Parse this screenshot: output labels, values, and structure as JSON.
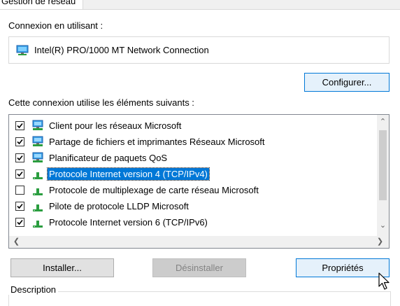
{
  "tab": {
    "label": "Gestion de réseau"
  },
  "connect_using": {
    "label": "Connexion en utilisant :",
    "adapter_name": "Intel(R) PRO/1000 MT Network Connection",
    "adapter_icon": "network-adapter-icon"
  },
  "configure_button": {
    "label": "Configurer..."
  },
  "items_section": {
    "label": "Cette connexion utilise les éléments suivants :",
    "items": [
      {
        "label": "Client pour les réseaux Microsoft",
        "checked": true,
        "icon": "network-client-icon",
        "selected": false
      },
      {
        "label": "Partage de fichiers et imprimantes Réseaux Microsoft",
        "checked": true,
        "icon": "file-printer-sharing-icon",
        "selected": false
      },
      {
        "label": "Planificateur de paquets QoS",
        "checked": true,
        "icon": "qos-scheduler-icon",
        "selected": false
      },
      {
        "label": "Protocole Internet version 4 (TCP/IPv4)",
        "checked": true,
        "icon": "protocol-icon",
        "selected": true
      },
      {
        "label": "Protocole de multiplexage de carte réseau Microsoft",
        "checked": false,
        "icon": "protocol-icon",
        "selected": false
      },
      {
        "label": "Pilote de protocole LLDP Microsoft",
        "checked": true,
        "icon": "protocol-icon",
        "selected": false
      },
      {
        "label": "Protocole Internet version 6 (TCP/IPv6)",
        "checked": true,
        "icon": "protocol-icon",
        "selected": false
      }
    ]
  },
  "buttons": {
    "install": "Installer...",
    "uninstall": "Désinstaller",
    "properties": "Propriétés"
  },
  "description": {
    "legend": "Description"
  },
  "colors": {
    "selection": "#0078d7",
    "button_face": "#e1e1e1",
    "button_hover": "#e5f1fb",
    "disabled_text": "#838383"
  }
}
